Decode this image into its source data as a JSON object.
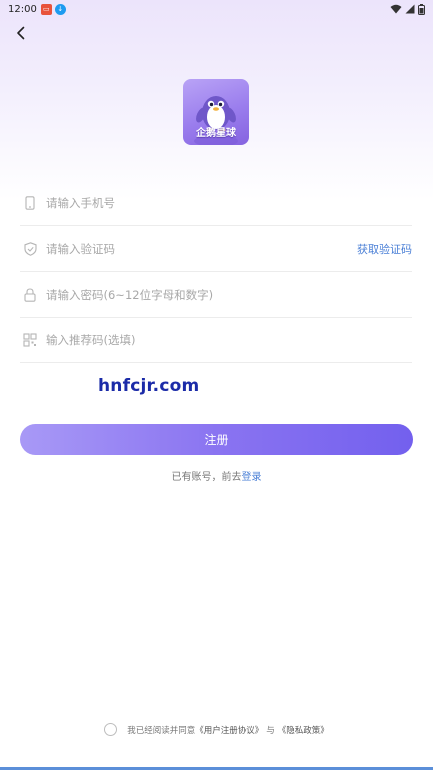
{
  "status_bar": {
    "time": "12:00"
  },
  "icons": {
    "back": "chevron-left-icon",
    "phone": "phone-icon",
    "shield": "shield-check-icon",
    "lock": "lock-icon",
    "qr": "qr-code-icon",
    "wifi": "wifi-icon",
    "signal": "signal-icon",
    "battery": "battery-icon"
  },
  "logo": {
    "text": "企鹅星球"
  },
  "form": {
    "phone_placeholder": "请输入手机号",
    "code_placeholder": "请输入验证码",
    "get_code_label": "获取验证码",
    "password_placeholder": "请输入密码(6~12位字母和数字)",
    "referral_placeholder": "输入推荐码(选填)"
  },
  "watermark": "hnfcjr.com",
  "register_label": "注册",
  "login_prompt": {
    "prefix": "已有账号，前去",
    "link": "登录"
  },
  "agreement": {
    "prefix": "我已经阅读并同意",
    "user_agreement": "《用户注册协议》",
    "conjunction": "与",
    "privacy_policy": "《隐私政策》"
  },
  "colors": {
    "accent": "#7a66ef",
    "link": "#4a7fd6",
    "hero_tint": "#ece4fb"
  }
}
